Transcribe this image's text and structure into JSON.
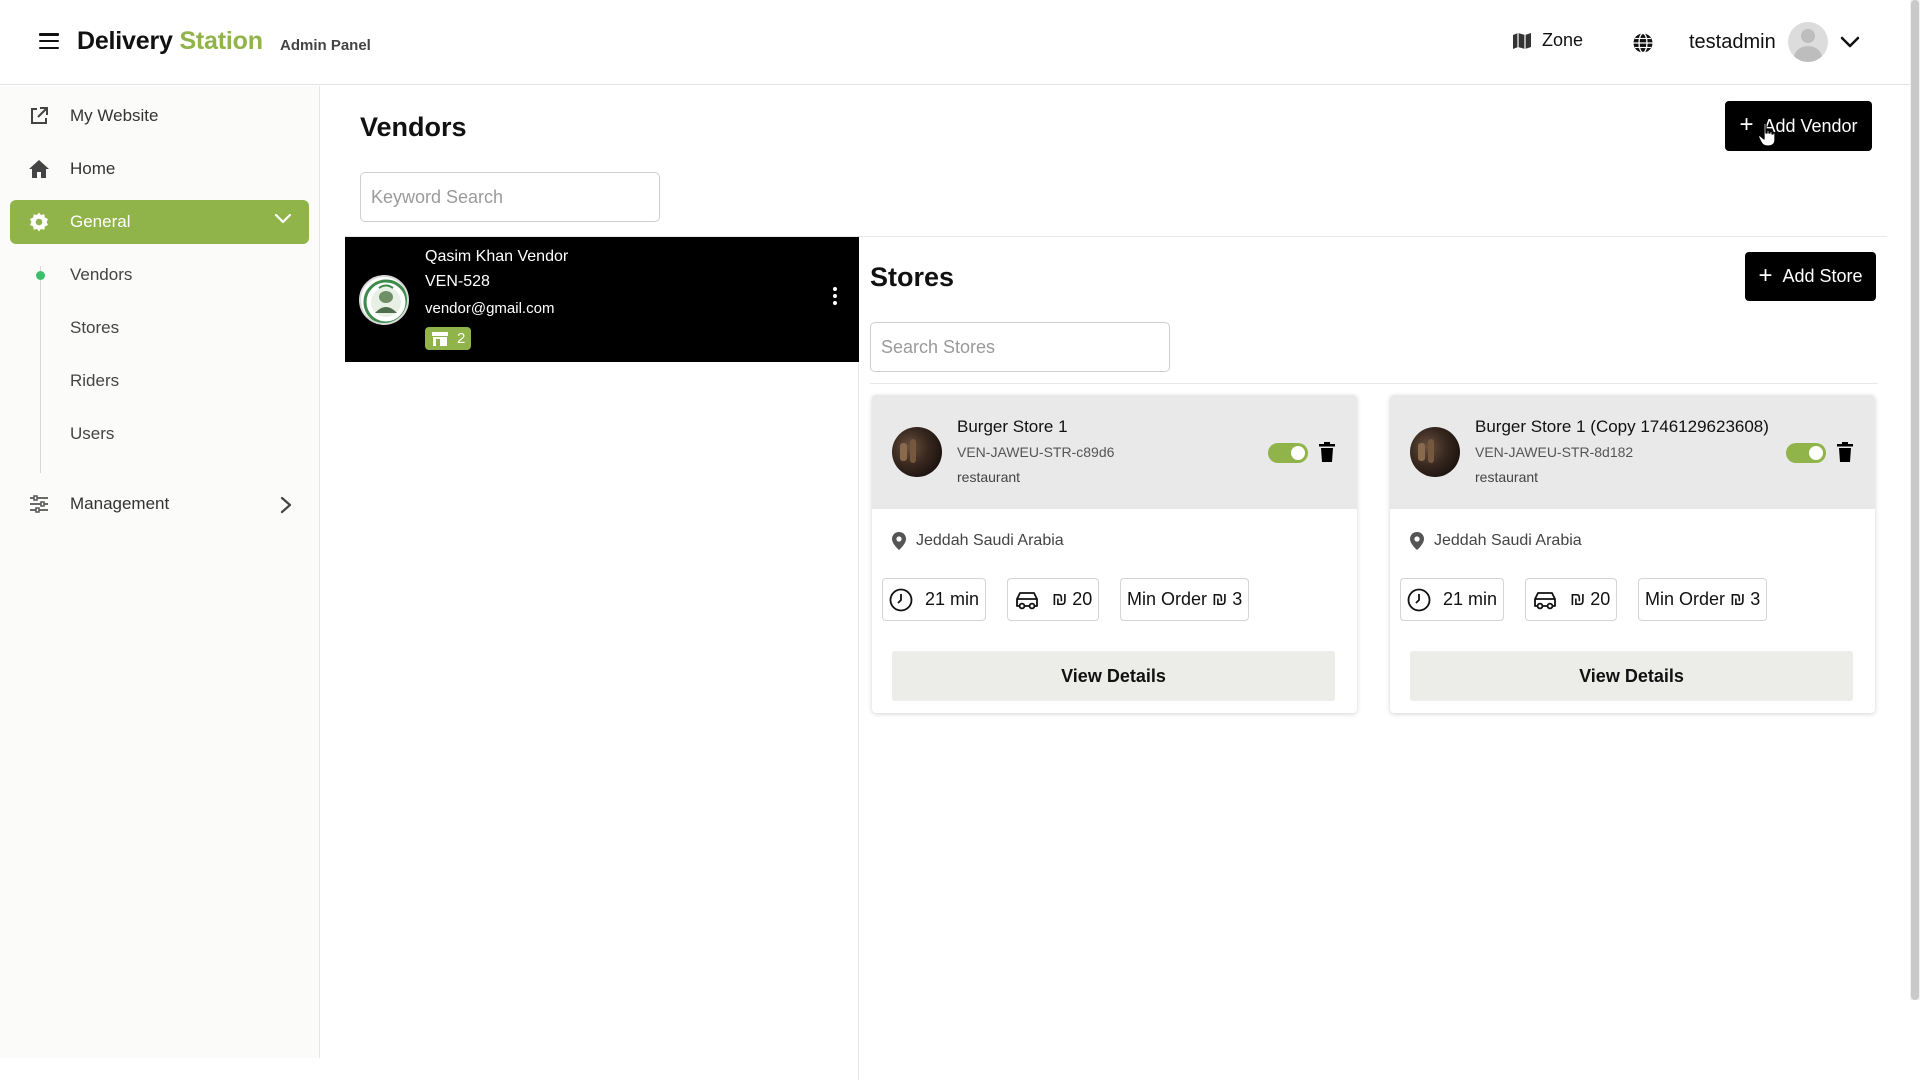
{
  "header": {
    "brand_main": "Delivery",
    "brand_accent": "Station",
    "brand_sub": "Admin Panel",
    "zone_label": "Zone",
    "username": "testadmin"
  },
  "sidebar": {
    "items": [
      {
        "label": "My Website",
        "icon": "external-link-icon"
      },
      {
        "label": "Home",
        "icon": "home-icon"
      },
      {
        "label": "General",
        "icon": "gear-icon",
        "active": true
      },
      {
        "label": "Management",
        "icon": "sliders-icon"
      }
    ],
    "sub_items": [
      {
        "label": "Vendors",
        "active": true
      },
      {
        "label": "Stores"
      },
      {
        "label": "Riders"
      },
      {
        "label": "Users"
      }
    ]
  },
  "page": {
    "title": "Vendors",
    "add_vendor": "Add Vendor",
    "search_placeholder": "Keyword Search"
  },
  "vendor": {
    "name": "Qasim Khan Vendor",
    "code": "VEN-528",
    "email": "vendor@gmail.com",
    "store_count": "2"
  },
  "stores": {
    "title": "Stores",
    "add_store": "Add Store",
    "search_placeholder": "Search Stores",
    "items": [
      {
        "name": "Burger Store 1",
        "code": "VEN-JAWEU-STR-c89d6",
        "type": "restaurant",
        "location": "Jeddah Saudi Arabia",
        "time": "21 min",
        "delivery": "₪ 20",
        "min_order": "Min Order ₪ 3",
        "enabled": true,
        "view_label": "View Details"
      },
      {
        "name": "Burger Store 1 (Copy 1746129623608)",
        "code": "VEN-JAWEU-STR-8d182",
        "type": "restaurant",
        "location": "Jeddah Saudi Arabia",
        "time": "21 min",
        "delivery": "₪ 20",
        "min_order": "Min Order ₪ 3",
        "enabled": true,
        "view_label": "View Details"
      }
    ]
  },
  "colors": {
    "accent": "#90b449",
    "dark": "#000000",
    "active_dot": "#3cbf6a"
  }
}
